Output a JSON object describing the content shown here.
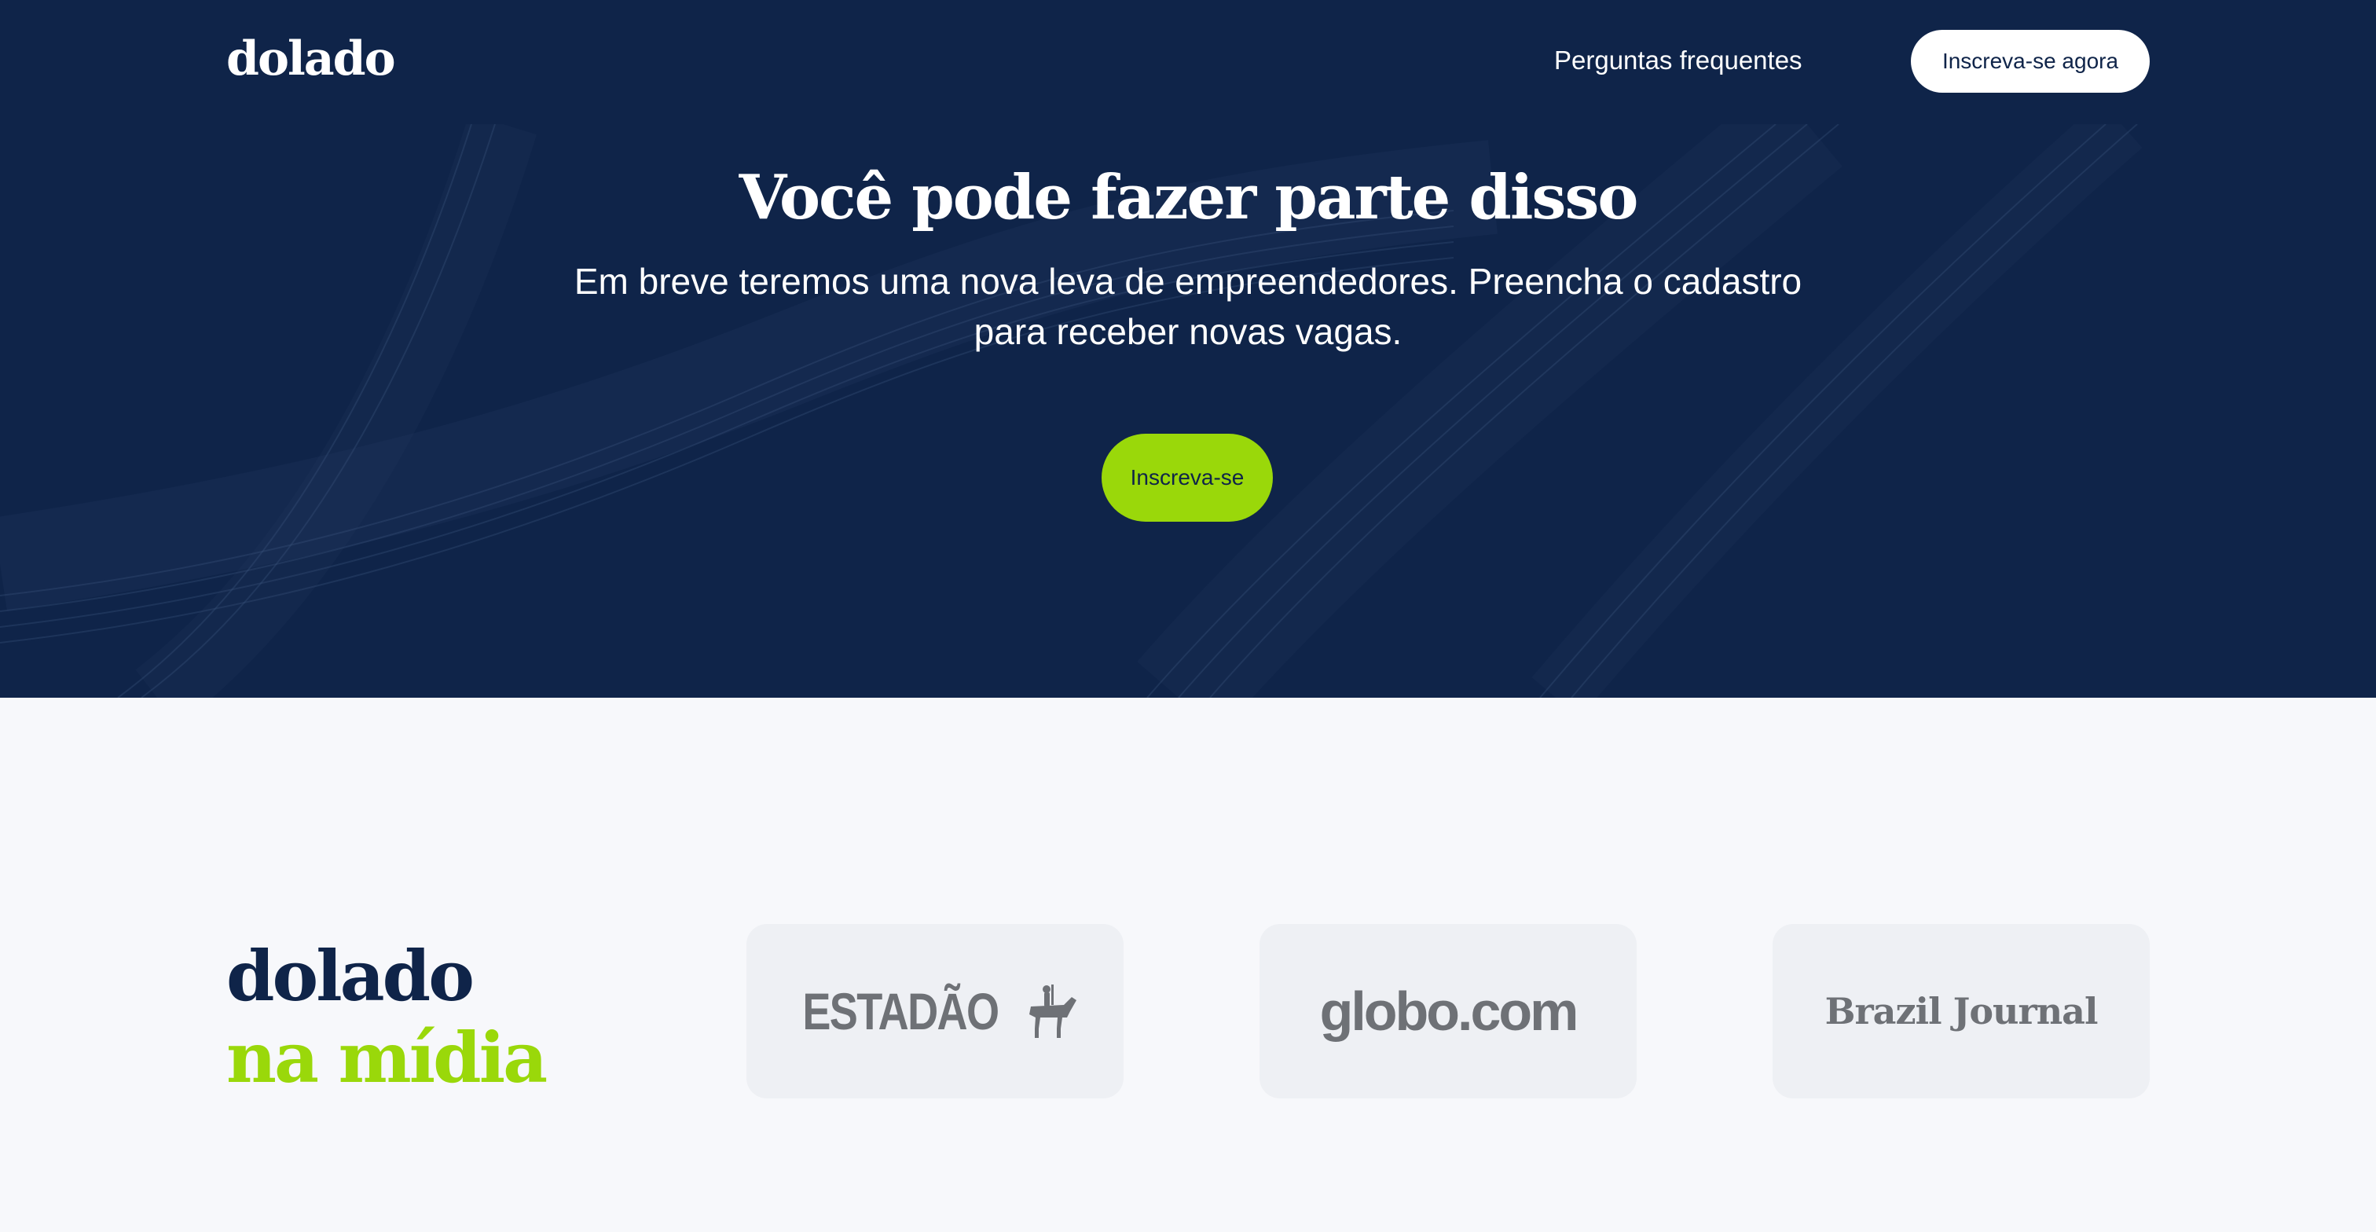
{
  "header": {
    "logo": "dolado",
    "nav_link": "Perguntas frequentes",
    "cta_label": "Inscreva-se agora"
  },
  "hero": {
    "title": "Você pode fazer parte disso",
    "subtitle": "Em breve teremos uma nova leva de empreendedores. Preencha o cadastro para receber novas vagas.",
    "cta_label": "Inscreva-se"
  },
  "media": {
    "title_line1": "dolado",
    "title_line2": "na mídia",
    "press": [
      {
        "name": "ESTADÃO",
        "icon": "horse-rider-icon"
      },
      {
        "name": "globo.com"
      },
      {
        "name": "Brazil Journal"
      }
    ]
  },
  "colors": {
    "navy": "#0f2449",
    "lime": "#9ad80a",
    "light_bg": "#f7f8fb",
    "card_bg": "#eef0f4",
    "logo_gray": "#6e7176"
  }
}
